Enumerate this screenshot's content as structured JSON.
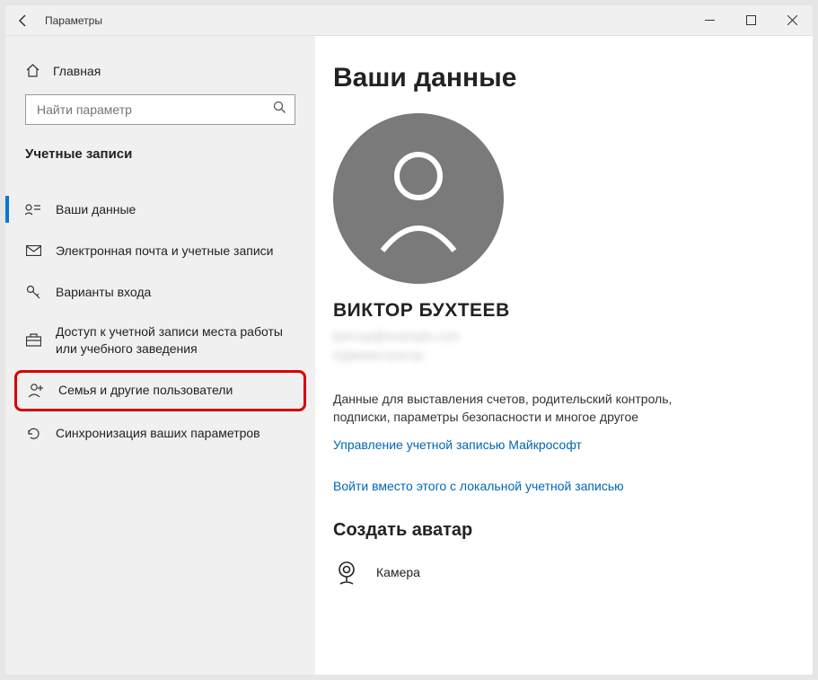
{
  "titlebar": {
    "title": "Параметры"
  },
  "sidebar": {
    "home": "Главная",
    "searchPlaceholder": "Найти параметр",
    "section": "Учетные записи",
    "items": [
      {
        "label": "Ваши данные"
      },
      {
        "label": "Электронная почта и учетные записи"
      },
      {
        "label": "Варианты входа"
      },
      {
        "label": "Доступ к учетной записи места работы или учебного заведения"
      },
      {
        "label": "Семья и другие пользователи"
      },
      {
        "label": "Синхронизация ваших параметров"
      }
    ]
  },
  "main": {
    "heading": "Ваши данные",
    "username": "ВИКТОР БУХТЕЕВ",
    "email": "виктор@example.com",
    "role": "Администратор",
    "description": "Данные для выставления счетов, родительский контроль, подписки, параметры безопасности и многое другое",
    "manageLink": "Управление учетной записью Майкрософт",
    "localLink": "Войти вместо этого с локальной учетной записью",
    "avatarSection": "Создать аватар",
    "camera": "Камера"
  }
}
